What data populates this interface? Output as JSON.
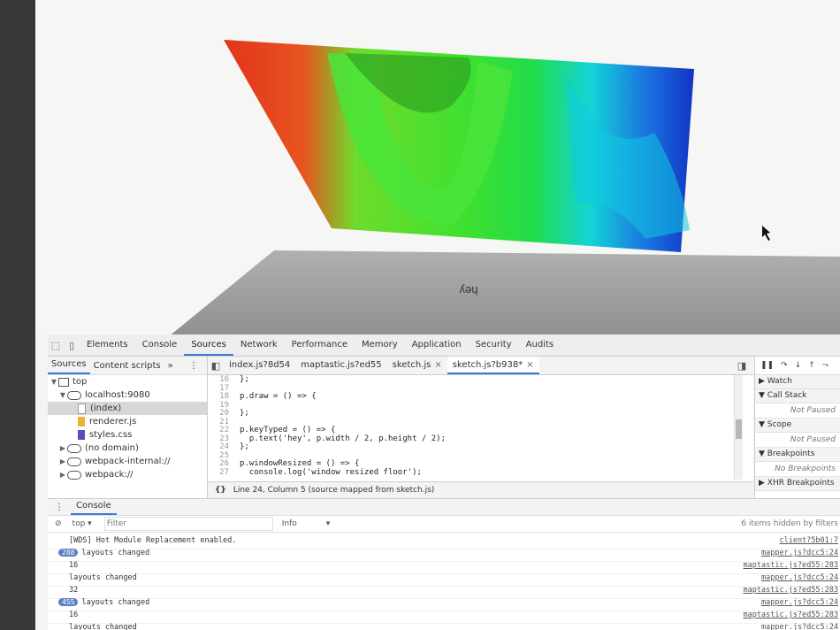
{
  "scene": {
    "floor_text": "hey",
    "colors": {
      "red": "#e2341b",
      "green": "#3ee030",
      "cyan": "#14d4d8",
      "blue": "#1234c4",
      "floor": "#a0a0a0"
    }
  },
  "devtools": {
    "main_tabs": [
      "Elements",
      "Console",
      "Sources",
      "Network",
      "Performance",
      "Memory",
      "Application",
      "Security",
      "Audits"
    ],
    "active_tab": "Sources",
    "navigator": {
      "tabs": [
        "Sources",
        "Content scripts"
      ],
      "more": "»",
      "menu": "⋮",
      "tree": [
        {
          "label": "top",
          "toggle": "▼",
          "icon": "frame-icon"
        },
        {
          "label": "localhost:9080",
          "toggle": "▼",
          "icon": "cloud-icon"
        },
        {
          "label": "(index)",
          "toggle": "",
          "icon": "file-icon",
          "selected": true
        },
        {
          "label": "renderer.js",
          "toggle": "",
          "icon": "js-file-icon"
        },
        {
          "label": "styles.css",
          "toggle": "",
          "icon": "css-file-icon"
        },
        {
          "label": "(no domain)",
          "toggle": "▶",
          "icon": "cloud-icon"
        },
        {
          "label": "webpack-internal://",
          "toggle": "▶",
          "icon": "cloud-icon"
        },
        {
          "label": "webpack://",
          "toggle": "▶",
          "icon": "cloud-icon"
        }
      ]
    },
    "editor": {
      "tabs": [
        {
          "label": "index.js?8d54",
          "close": ""
        },
        {
          "label": "maptastic.js?ed55",
          "close": ""
        },
        {
          "label": "sketch.js",
          "close": "×"
        },
        {
          "label": "sketch.js?b938*",
          "close": "×"
        }
      ],
      "lines": [
        {
          "n": "16",
          "text": "};"
        },
        {
          "n": "17",
          "text": ""
        },
        {
          "n": "18",
          "text": "p.draw = () => {"
        },
        {
          "n": "19",
          "text": ""
        },
        {
          "n": "20",
          "text": "};"
        },
        {
          "n": "21",
          "text": ""
        },
        {
          "n": "22",
          "text": "p.keyTyped = () => {"
        },
        {
          "n": "23",
          "text": "  p.text('hey', p.width / 2, p.height / 2);"
        },
        {
          "n": "24",
          "text": "};"
        },
        {
          "n": "25",
          "text": ""
        },
        {
          "n": "26",
          "text": "p.windowResized = () => {"
        },
        {
          "n": "27",
          "text": "  console.log('window resized floor');"
        }
      ],
      "status_icon": "{}",
      "status": "Line 24, Column 5   (source mapped from sketch.js)"
    },
    "debugger": {
      "panes": [
        {
          "title": "Watch",
          "toggle": "▶",
          "body": ""
        },
        {
          "title": "Call Stack",
          "toggle": "▼",
          "body": "Not Paused"
        },
        {
          "title": "Scope",
          "toggle": "▼",
          "body": "Not Paused"
        },
        {
          "title": "Breakpoints",
          "toggle": "▼",
          "body": "No Breakpoints"
        },
        {
          "title": "XHR Breakpoints",
          "toggle": "▶",
          "body": ""
        }
      ]
    },
    "console": {
      "tab": "Console",
      "context": "top",
      "filter_placeholder": "Filter",
      "level": "Info",
      "hidden": "6 items hidden by filters",
      "rows": [
        {
          "count": "",
          "msg": "[WDS] Hot Module Replacement enabled.",
          "src": "client?5b01:7"
        },
        {
          "count": "288",
          "msg": "layouts changed",
          "src": "mapper.js?dcc5:24"
        },
        {
          "count": "",
          "msg": "16",
          "src": "maptastic.js?ed55:283"
        },
        {
          "count": "",
          "msg": "layouts changed",
          "src": "mapper.js?dcc5:24"
        },
        {
          "count": "",
          "msg": "32",
          "src": "maptastic.js?ed55:283"
        },
        {
          "count": "455",
          "msg": "layouts changed",
          "src": "mapper.js?dcc5:24"
        },
        {
          "count": "",
          "msg": "16",
          "src": "maptastic.js?ed55:283"
        },
        {
          "count": "",
          "msg": "layouts changed",
          "src": "mapper.js?dcc5:24"
        }
      ]
    }
  }
}
